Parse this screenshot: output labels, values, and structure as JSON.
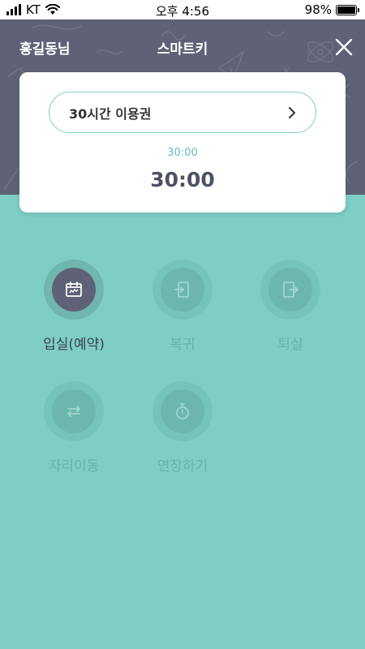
{
  "status_bar": {
    "carrier": "KT",
    "time": "오후 4:56",
    "battery": "98%",
    "battery_level": 0.98
  },
  "header": {
    "user_name": "홍길동님",
    "title": "스마트키"
  },
  "ticket": {
    "name": "30시간 이용권",
    "time_small": "30:00",
    "time_large": "30:00"
  },
  "actions": [
    {
      "label": "입실(예약)",
      "icon": "calendar-icon",
      "enabled": true
    },
    {
      "label": "복귀",
      "icon": "enter-icon",
      "enabled": false
    },
    {
      "label": "퇴실",
      "icon": "exit-icon",
      "enabled": false
    },
    {
      "label": "자리이동",
      "icon": "swap-arrows-icon",
      "enabled": false
    },
    {
      "label": "연장하기",
      "icon": "stopwatch-icon",
      "enabled": false
    }
  ],
  "colors": {
    "header_bg": "#5f6276",
    "body_bg": "#7ecec5",
    "accent": "#5fbfb3"
  }
}
